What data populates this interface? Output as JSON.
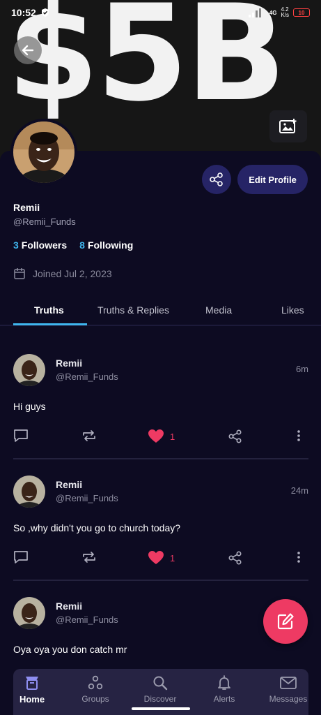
{
  "status_bar": {
    "time": "10:52",
    "network": "4G",
    "speed": "4.2\nK/s",
    "battery": "10"
  },
  "banner": {
    "text": "$5B"
  },
  "profile": {
    "display_name": "Remii",
    "handle": "@Remii_Funds",
    "followers_count": "3",
    "followers_label": "Followers",
    "following_count": "8",
    "following_label": "Following",
    "joined": "Joined Jul 2, 2023",
    "edit_label": "Edit Profile"
  },
  "tabs": [
    {
      "label": "Truths"
    },
    {
      "label": "Truths & Replies"
    },
    {
      "label": "Media"
    },
    {
      "label": "Likes"
    }
  ],
  "posts": [
    {
      "name": "Remii",
      "handle": "@Remii_Funds",
      "time": "6m",
      "text": "Hi guys",
      "likes": "1"
    },
    {
      "name": "Remii",
      "handle": "@Remii_Funds",
      "time": "24m",
      "text": "So ,why didn't you go to church today?",
      "likes": "1"
    },
    {
      "name": "Remii",
      "handle": "@Remii_Funds",
      "time": "",
      "text": "Oya oya you don catch mr",
      "likes": ""
    }
  ],
  "nav": [
    {
      "label": "Home",
      "icon": "home-icon"
    },
    {
      "label": "Groups",
      "icon": "groups-icon"
    },
    {
      "label": "Discover",
      "icon": "search-icon"
    },
    {
      "label": "Alerts",
      "icon": "bell-icon"
    },
    {
      "label": "Messages",
      "icon": "mail-icon"
    }
  ],
  "colors": {
    "accent": "#3fb6ee",
    "like": "#ee3a63",
    "background": "#0d0b22",
    "button": "#262466"
  }
}
